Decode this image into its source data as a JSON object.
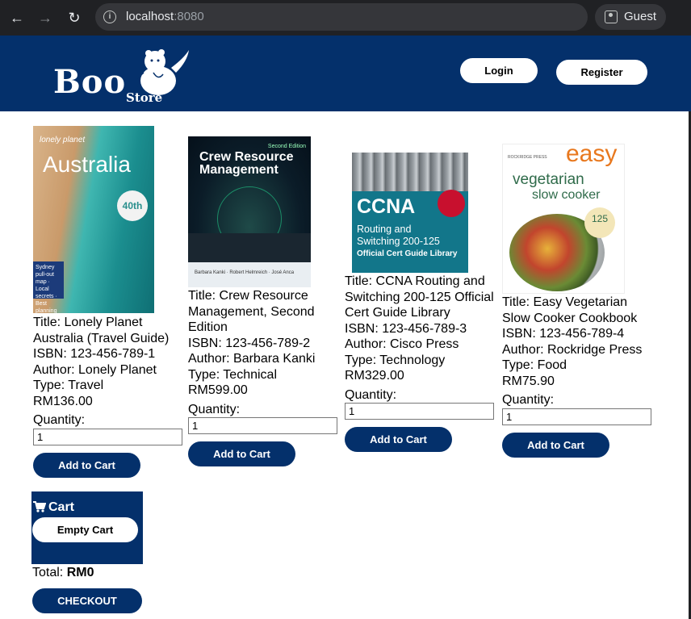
{
  "browser": {
    "url_host": "localhost",
    "url_port": ":8080",
    "profile_label": "Guest"
  },
  "header": {
    "logo_text": "Boo",
    "logo_sub": "Store",
    "login_label": "Login",
    "register_label": "Register",
    "brand_color": "#04306b"
  },
  "products": [
    {
      "cover": {
        "brand": "lonely planet",
        "title": "Australia",
        "badge": "40th",
        "side": "Sydney pull-out map · Local secrets · Best planning advice"
      },
      "title": "Title: Lonely Planet Australia (Travel Guide)",
      "isbn": "ISBN: 123-456-789-1",
      "author": "Author: Lonely Planet",
      "type": "Type: Travel",
      "price": "RM136.00",
      "quantity_label": "Quantity:",
      "quantity_value": "1",
      "add_label": "Add to Cart"
    },
    {
      "cover": {
        "edition": "Second Edition",
        "title": "Crew Resource Management",
        "foot": "Barbara Kanki · Robert Helmreich · José Anca"
      },
      "title": "Title: Crew Resource Management, Second Edition",
      "isbn": "ISBN: 123-456-789-2",
      "author": "Author: Barbara Kanki",
      "type": "Type: Technical",
      "price": "RM599.00",
      "quantity_label": "Quantity:",
      "quantity_value": "1",
      "add_label": "Add to Cart"
    },
    {
      "cover": {
        "title": "CCNA",
        "sub1": "Routing and",
        "sub2": "Switching 200-125",
        "sub3": "Official Cert Guide Library"
      },
      "title": "Title: CCNA Routing and Switching 200-125 Official Cert Guide Library",
      "isbn": "ISBN: 123-456-789-3",
      "author": "Author: Cisco Press",
      "type": "Type: Technology",
      "price": "RM329.00",
      "quantity_label": "Quantity:",
      "quantity_value": "1",
      "add_label": "Add to Cart"
    },
    {
      "cover": {
        "publisher": "ROCKRIDGE PRESS",
        "word1": "easy",
        "word2": "vegetarian",
        "word3": "slow cooker",
        "badge": "125"
      },
      "title": "Title: Easy Vegetarian Slow Cooker Cookbook",
      "isbn": "ISBN: 123-456-789-4",
      "author": "Author: Rockridge Press",
      "type": "Type: Food",
      "price": "RM75.90",
      "quantity_label": "Quantity:",
      "quantity_value": "1",
      "add_label": "Add to Cart"
    }
  ],
  "cart": {
    "title": "Cart",
    "empty_label": "Empty Cart",
    "total_label": "Total:",
    "total_value": "RM0",
    "checkout_label": "CHECKOUT"
  }
}
